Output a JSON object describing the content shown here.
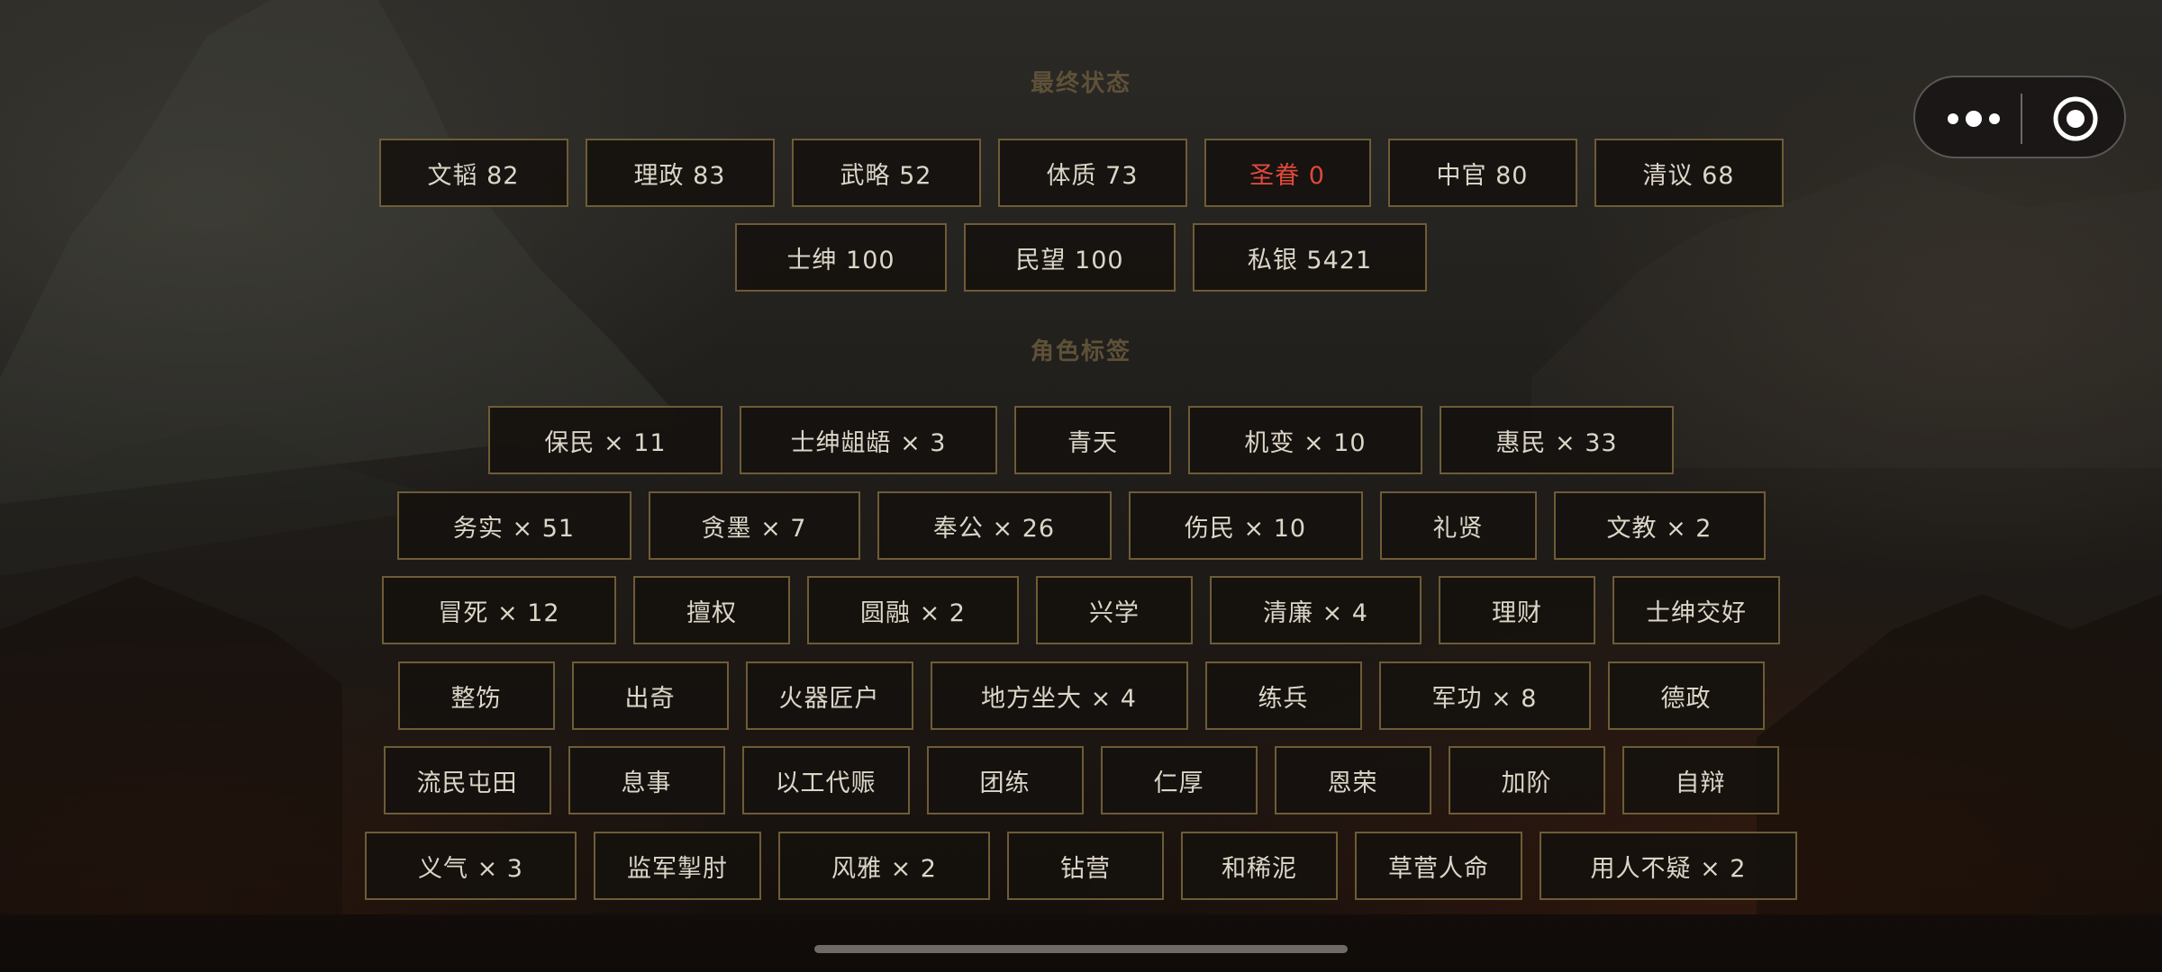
{
  "sections": {
    "final_state_title": "最终状态",
    "tags_title": "角色标签"
  },
  "stats_rows": [
    [
      {
        "text": "文韬 82",
        "highlight": false
      },
      {
        "text": "理政 83",
        "highlight": false
      },
      {
        "text": "武略 52",
        "highlight": false
      },
      {
        "text": "体质 73",
        "highlight": false
      },
      {
        "text": "圣眷 0",
        "highlight": true
      },
      {
        "text": "中官 80",
        "highlight": false
      },
      {
        "text": "清议 68",
        "highlight": false
      }
    ],
    [
      {
        "text": "士绅 100",
        "highlight": false
      },
      {
        "text": "民望 100",
        "highlight": false
      },
      {
        "text": "私银 5421",
        "highlight": false
      }
    ]
  ],
  "tag_rows": [
    [
      "保民 × 11",
      "士绅龃龉 × 3",
      "青天",
      "机变 × 10",
      "惠民 × 33"
    ],
    [
      "务实 × 51",
      "贪墨 × 7",
      "奉公 × 26",
      "伤民 × 10",
      "礼贤",
      "文教 × 2"
    ],
    [
      "冒死 × 12",
      "擅权",
      "圆融 × 2",
      "兴学",
      "清廉 × 4",
      "理财",
      "士绅交好"
    ],
    [
      "整饬",
      "出奇",
      "火器匠户",
      "地方坐大 × 4",
      "练兵",
      "军功 × 8",
      "德政"
    ],
    [
      "流民屯田",
      "息事",
      "以工代赈",
      "团练",
      "仁厚",
      "恩荣",
      "加阶",
      "自辩"
    ],
    [
      "义气 × 3",
      "监军掣肘",
      "风雅 × 2",
      "钻营",
      "和稀泥",
      "草菅人命",
      "用人不疑 × 2"
    ],
    [
      "",
      "",
      "",
      "",
      "",
      "",
      ""
    ]
  ],
  "colors": {
    "accent_gold": "#6e5c36",
    "title_text": "#5e5138",
    "item_text": "#dcd6c8",
    "highlight_red": "#e0483c"
  },
  "icons": {
    "menu": "more-dots-icon",
    "close": "target-circle-icon"
  }
}
